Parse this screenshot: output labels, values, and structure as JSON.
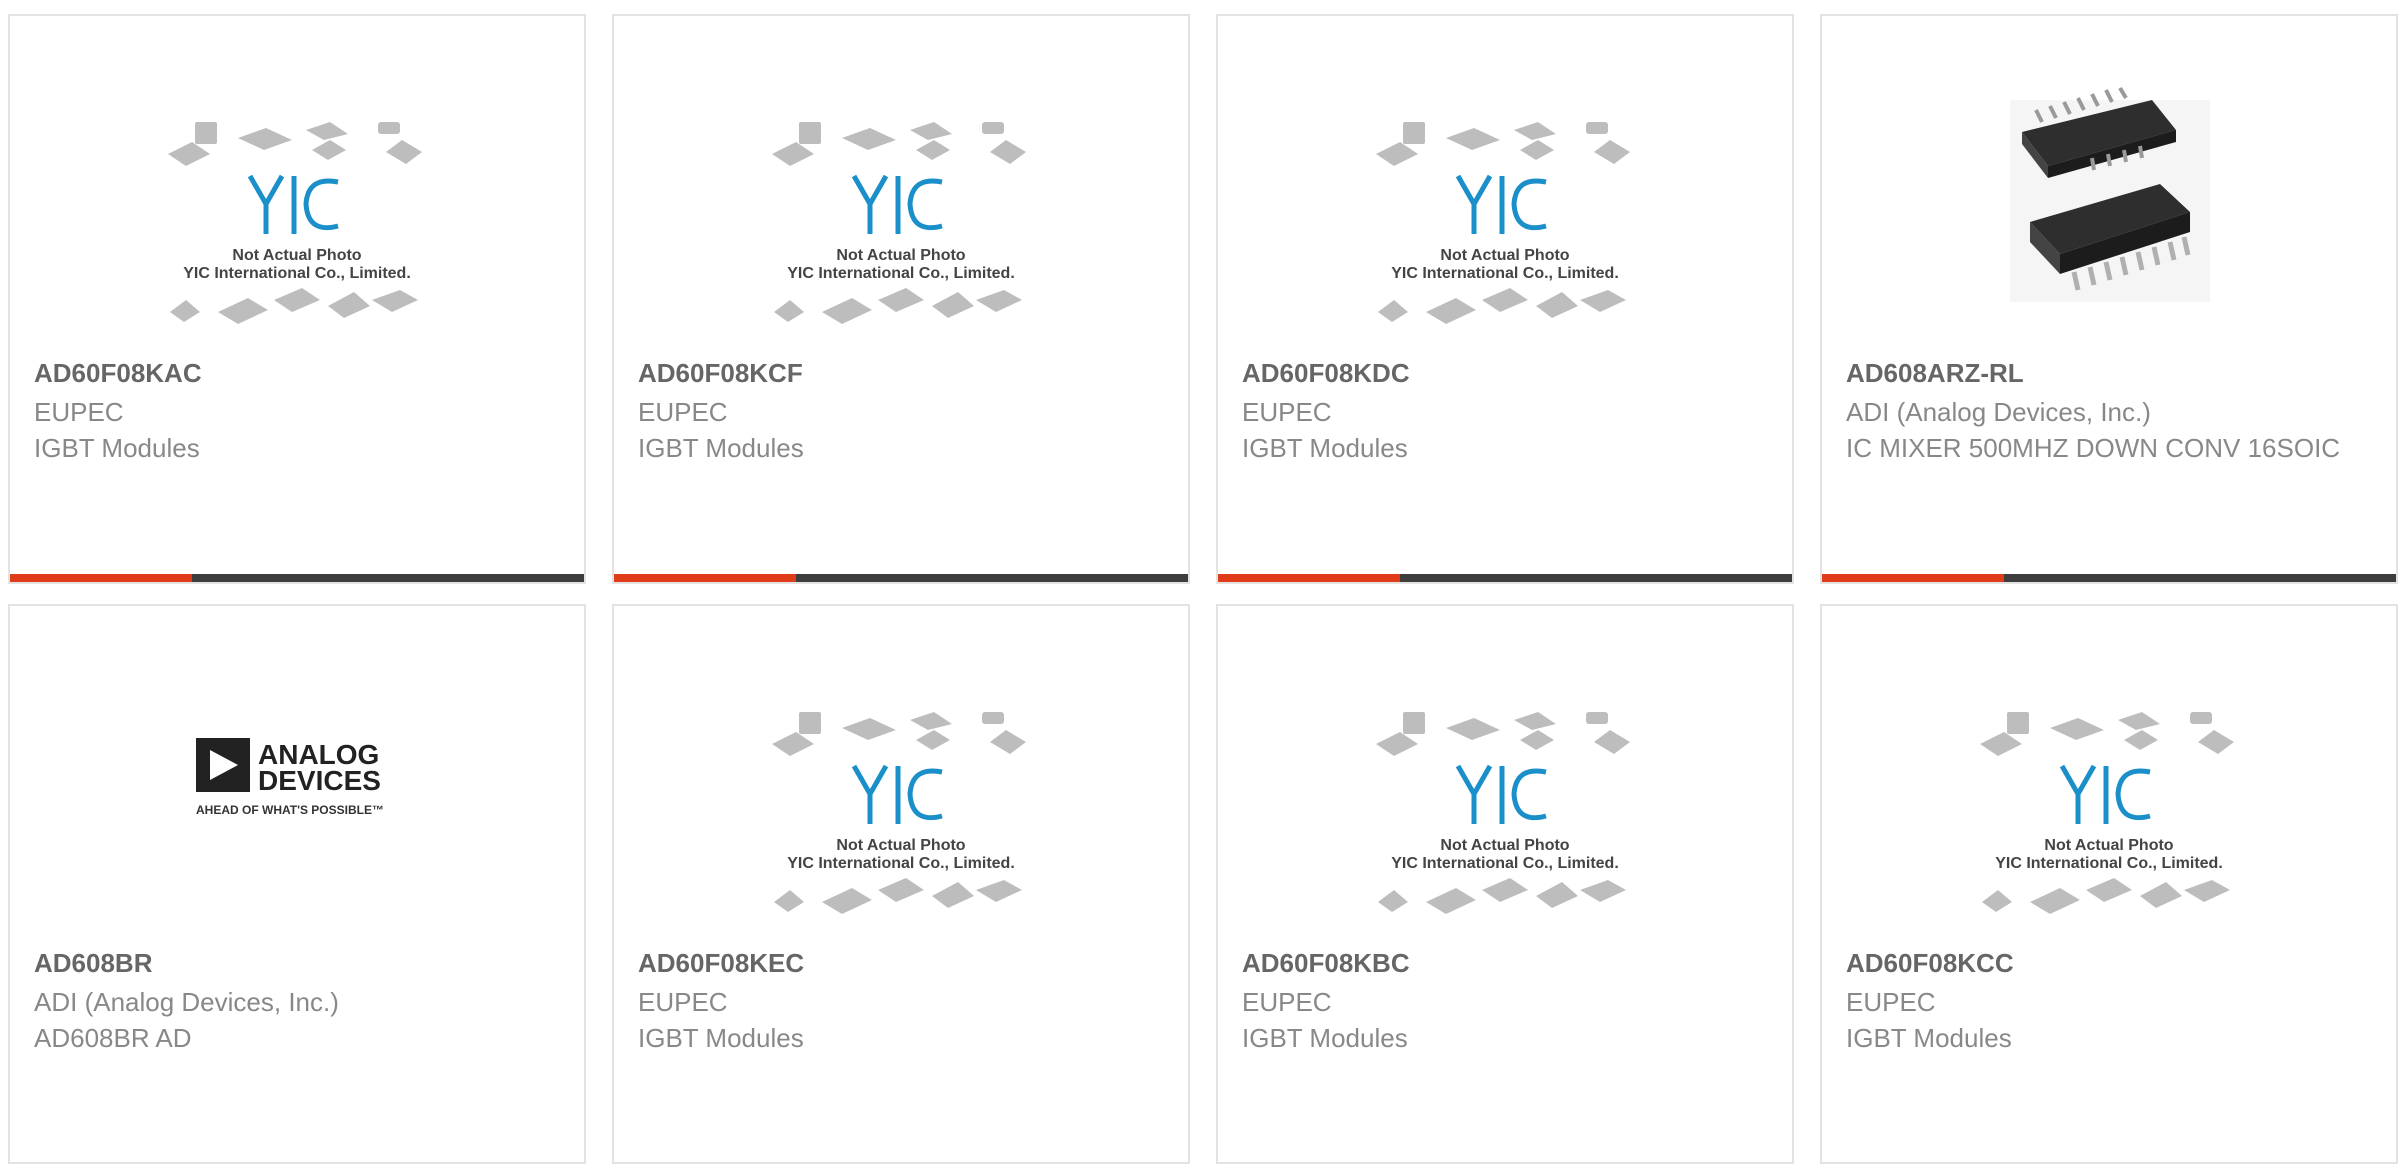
{
  "products": [
    {
      "part": "AD60F08KAC",
      "manufacturer": "EUPEC",
      "description": "IGBT Modules",
      "image": "placeholder-photo",
      "photo_line1": "Not Actual Photo",
      "photo_line2": "YIC International Co., Limited."
    },
    {
      "part": "AD60F08KCF",
      "manufacturer": "EUPEC",
      "description": "IGBT Modules",
      "image": "placeholder-photo",
      "photo_line1": "Not Actual Photo",
      "photo_line2": "YIC International Co., Limited."
    },
    {
      "part": "AD60F08KDC",
      "manufacturer": "EUPEC",
      "description": "IGBT Modules",
      "image": "placeholder-photo",
      "photo_line1": "Not Actual Photo",
      "photo_line2": "YIC International Co., Limited."
    },
    {
      "part": "AD608ARZ-RL",
      "manufacturer": "ADI (Analog Devices, Inc.)",
      "description": "IC MIXER 500MHZ DOWN CONV 16SOIC",
      "image": "soic-chip-photo"
    },
    {
      "part": "AD608BR",
      "manufacturer": "ADI (Analog Devices, Inc.)",
      "description": "AD608BR AD",
      "image": "analog-devices-logo",
      "logo_line1": "ANALOG",
      "logo_line2": "DEVICES",
      "logo_tagline": "AHEAD OF WHAT'S POSSIBLE™"
    },
    {
      "part": "AD60F08KEC",
      "manufacturer": "EUPEC",
      "description": "IGBT Modules",
      "image": "placeholder-photo",
      "photo_line1": "Not Actual Photo",
      "photo_line2": "YIC International Co., Limited."
    },
    {
      "part": "AD60F08KBC",
      "manufacturer": "EUPEC",
      "description": "IGBT Modules",
      "image": "placeholder-photo",
      "photo_line1": "Not Actual Photo",
      "photo_line2": "YIC International Co., Limited."
    },
    {
      "part": "AD60F08KCC",
      "manufacturer": "EUPEC",
      "description": "IGBT Modules",
      "image": "placeholder-photo",
      "photo_line1": "Not Actual Photo",
      "photo_line2": "YIC International Co., Limited."
    }
  ],
  "colors": {
    "accent_red": "#e03c1a",
    "accent_dark": "#3d3d3d",
    "yic_blue": "#1b8fc9"
  }
}
